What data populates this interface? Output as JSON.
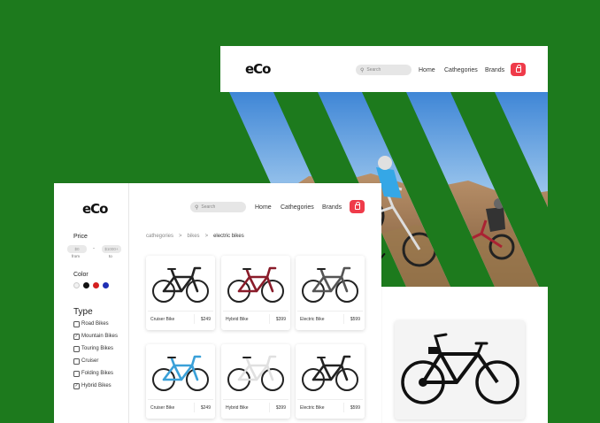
{
  "back": {
    "logo": "eCo",
    "search_placeholder": "Search",
    "nav": [
      "Home",
      "Cathegories",
      "Brands"
    ],
    "hero_icon": "mountain-bikers-photo",
    "featured_icon": "electric-bike-photo"
  },
  "front": {
    "logo": "eCo",
    "search_placeholder": "Search",
    "nav": [
      "Home",
      "Cathegories",
      "Brands"
    ],
    "filters": {
      "price_label": "Price",
      "from_value": "$0",
      "from_label": "from",
      "to_value": "$1000+",
      "to_label": "to",
      "color_label": "Color",
      "colors": [
        "#f2f2f2",
        "#111111",
        "#d41f1f",
        "#1f2fb4"
      ],
      "type_label": "Type",
      "types": [
        {
          "label": "Road Bikes",
          "checked": false
        },
        {
          "label": "Mountain Bikes",
          "checked": true
        },
        {
          "label": "Touring Bikes",
          "checked": false
        },
        {
          "label": "Cruiser",
          "checked": false
        },
        {
          "label": "Folding Bikes",
          "checked": false
        },
        {
          "label": "Hybrid Bikes",
          "checked": true
        }
      ]
    },
    "breadcrumbs": [
      "cathegories",
      ">",
      "bikes",
      ">",
      "electric bikes"
    ],
    "products": [
      {
        "name": "Cruiser Bike",
        "price": "$249",
        "frame": "#222222"
      },
      {
        "name": "Hybrid Bike",
        "price": "$399",
        "frame": "#8a1c2a"
      },
      {
        "name": "Electric Bike",
        "price": "$599",
        "frame": "#555555"
      },
      {
        "name": "Cruiser Bike",
        "price": "$249",
        "frame": "#3aa0d8"
      },
      {
        "name": "Hybrid Bike",
        "price": "$399",
        "frame": "#e0e0e0"
      },
      {
        "name": "Electric Bike",
        "price": "$599",
        "frame": "#222222"
      }
    ]
  },
  "colors": {
    "background": "#1d7a1d",
    "accent": "#ef3b4a"
  }
}
